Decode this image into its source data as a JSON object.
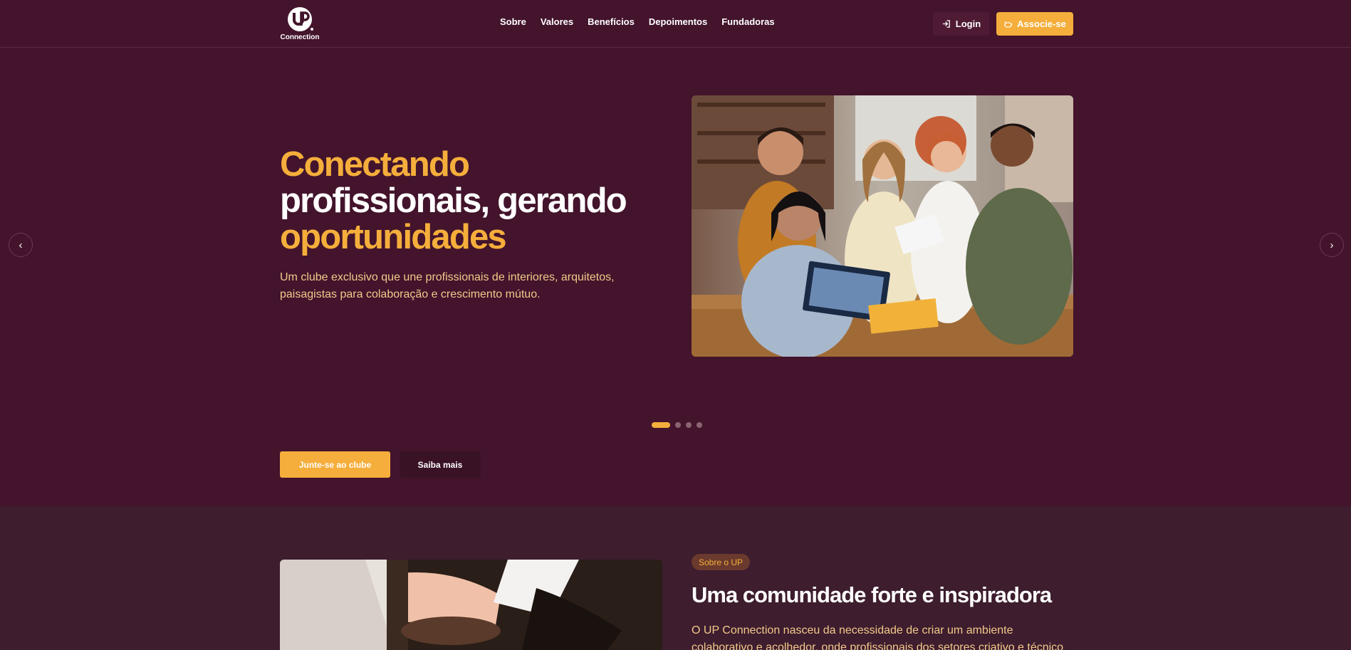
{
  "brand": {
    "name": "Connection",
    "mark": "UP"
  },
  "nav": {
    "items": [
      "Sobre",
      "Valores",
      "Benefícios",
      "Depoimentos",
      "Fundadoras"
    ]
  },
  "header": {
    "login_label": "Login",
    "associe_label": "Associe-se"
  },
  "hero": {
    "title_line1": "Conectando",
    "title_line2": "profissionais, gerando",
    "title_line3": "oportunidades",
    "subtitle": "Um clube exclusivo que une profissionais de interiores, arquitetos, paisagistas para colaboração e crescimento mútuo.",
    "prev_arrow": "‹",
    "next_arrow": "›",
    "cta_primary": "Junte-se ao clube",
    "cta_secondary": "Saiba mais",
    "slides_total": 4,
    "slide_active": 1
  },
  "about": {
    "badge": "Sobre o UP",
    "title": "Uma comunidade forte e inspiradora",
    "text": "O UP Connection nasceu da necessidade de criar um ambiente colaborativo e acolhedor, onde profissionais dos setores criativo e técnico"
  },
  "colors": {
    "background": "#43142c",
    "accent": "#f5ae3b",
    "section_bg": "#3d1d2e",
    "subtitle": "#f3c98a"
  },
  "icons": {
    "login": "login-icon",
    "associe": "piggy-bank-icon",
    "prev": "chevron-left-icon",
    "next": "chevron-right-icon"
  }
}
